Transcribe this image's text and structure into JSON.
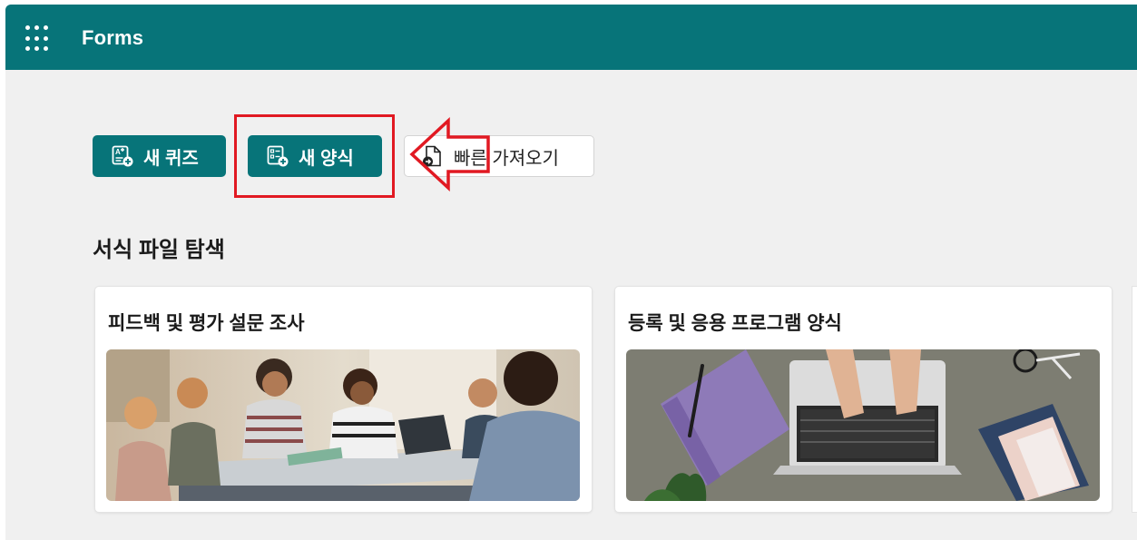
{
  "header": {
    "app_title": "Forms",
    "waffle_icon": "app-launcher-icon"
  },
  "actions": {
    "new_quiz": "새 퀴즈",
    "new_form": "새 양식",
    "quick_import": "빠른 가져오기"
  },
  "templates": {
    "section_title": "서식 파일 탐색",
    "cards": [
      {
        "title": "피드백 및 평가 설문 조사"
      },
      {
        "title": "등록 및 응용 프로그램 양식"
      }
    ]
  },
  "colors": {
    "brand": "#077479",
    "annotation": "#e11922",
    "background": "#f0f0f0"
  }
}
